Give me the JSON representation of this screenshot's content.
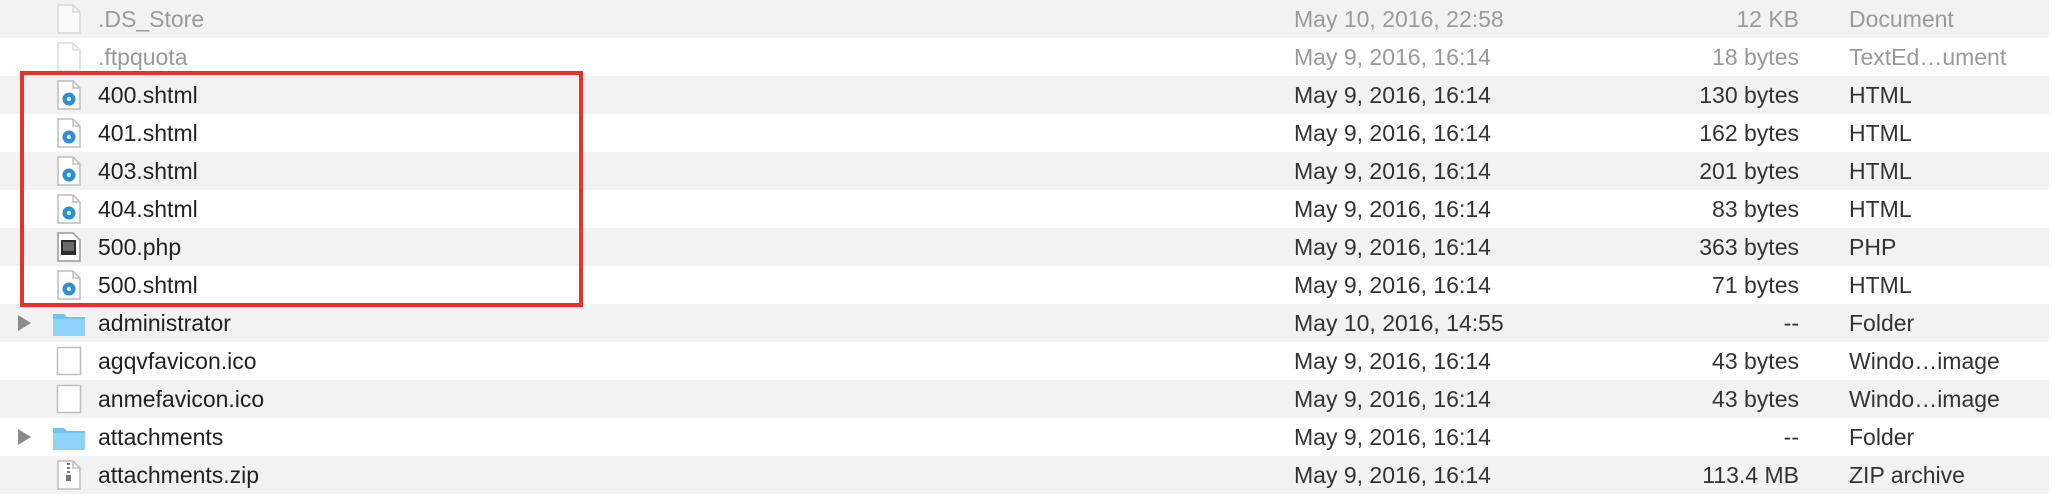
{
  "files": [
    {
      "name": ".DS_Store",
      "date": "May 10, 2016, 22:58",
      "size": "12 KB",
      "kind": "Document",
      "icon": "document-icon",
      "dimmed": true,
      "folder": false
    },
    {
      "name": ".ftpquota",
      "date": "May 9, 2016, 16:14",
      "size": "18 bytes",
      "kind": "TextEd…ument",
      "icon": "document-icon",
      "dimmed": true,
      "folder": false
    },
    {
      "name": "400.shtml",
      "date": "May 9, 2016, 16:14",
      "size": "130 bytes",
      "kind": "HTML",
      "icon": "html-file-icon",
      "dimmed": false,
      "folder": false
    },
    {
      "name": "401.shtml",
      "date": "May 9, 2016, 16:14",
      "size": "162 bytes",
      "kind": "HTML",
      "icon": "html-file-icon",
      "dimmed": false,
      "folder": false
    },
    {
      "name": "403.shtml",
      "date": "May 9, 2016, 16:14",
      "size": "201 bytes",
      "kind": "HTML",
      "icon": "html-file-icon",
      "dimmed": false,
      "folder": false
    },
    {
      "name": "404.shtml",
      "date": "May 9, 2016, 16:14",
      "size": "83 bytes",
      "kind": "HTML",
      "icon": "html-file-icon",
      "dimmed": false,
      "folder": false
    },
    {
      "name": "500.php",
      "date": "May 9, 2016, 16:14",
      "size": "363 bytes",
      "kind": "PHP",
      "icon": "php-file-icon",
      "dimmed": false,
      "folder": false
    },
    {
      "name": "500.shtml",
      "date": "May 9, 2016, 16:14",
      "size": "71 bytes",
      "kind": "HTML",
      "icon": "html-file-icon",
      "dimmed": false,
      "folder": false
    },
    {
      "name": "administrator",
      "date": "May 10, 2016, 14:55",
      "size": "--",
      "kind": "Folder",
      "icon": "folder-icon",
      "dimmed": false,
      "folder": true
    },
    {
      "name": "agqvfavicon.ico",
      "date": "May 9, 2016, 16:14",
      "size": "43 bytes",
      "kind": "Windo…image",
      "icon": "image-file-icon",
      "dimmed": false,
      "folder": false
    },
    {
      "name": "anmefavicon.ico",
      "date": "May 9, 2016, 16:14",
      "size": "43 bytes",
      "kind": "Windo…image",
      "icon": "image-file-icon",
      "dimmed": false,
      "folder": false
    },
    {
      "name": "attachments",
      "date": "May 9, 2016, 16:14",
      "size": "--",
      "kind": "Folder",
      "icon": "folder-icon",
      "dimmed": false,
      "folder": true
    },
    {
      "name": "attachments.zip",
      "date": "May 9, 2016, 16:14",
      "size": "113.4 MB",
      "kind": "ZIP archive",
      "icon": "zip-file-icon",
      "dimmed": false,
      "folder": false
    }
  ],
  "colors": {
    "highlight_border": "#e8312b",
    "folder": "#6cc4f4",
    "html_badge": "#2d8fd5",
    "stripe": "#f2f2f2"
  }
}
